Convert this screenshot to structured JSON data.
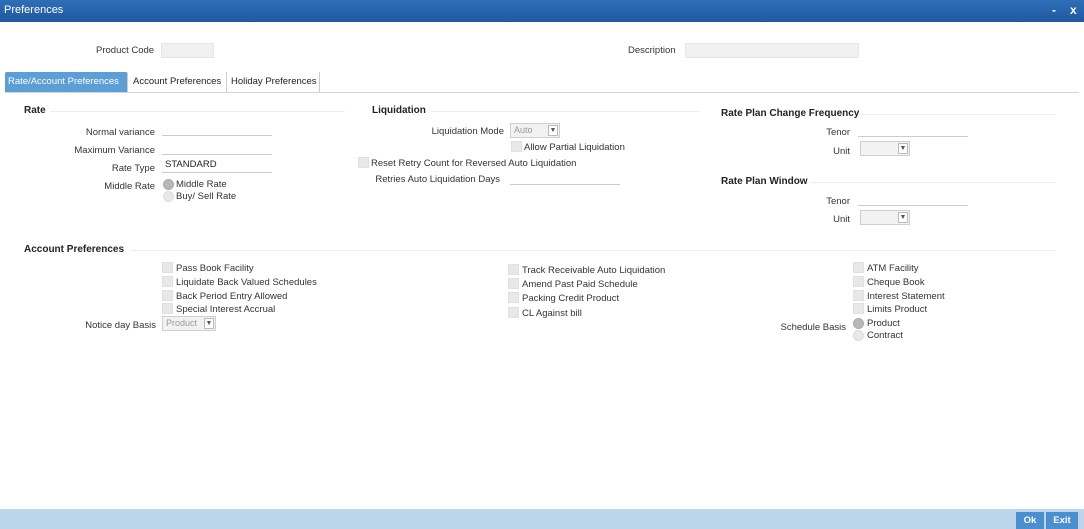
{
  "window": {
    "title": "Preferences",
    "minimize": "-",
    "close": "x"
  },
  "header": {
    "product_code_label": "Product Code",
    "description_label": "Description"
  },
  "tabs": [
    {
      "label": "Rate/Account Preferences",
      "active": true
    },
    {
      "label": "Account Preferences",
      "active": false
    },
    {
      "label": "Holiday Preferences",
      "active": false
    }
  ],
  "rate": {
    "heading": "Rate",
    "normal_variance_label": "Normal variance",
    "maximum_variance_label": "Maximum Variance",
    "rate_type_label": "Rate Type",
    "rate_type_value": "STANDARD",
    "middle_rate_label": "Middle Rate",
    "opt_middle_rate": "Middle Rate",
    "opt_buy_sell_rate": "Buy/ Sell Rate"
  },
  "liquidation": {
    "heading": "Liquidation",
    "mode_label": "Liquidation Mode",
    "mode_value": "Auto",
    "allow_partial_label": "Allow Partial Liquidation",
    "reset_retry_label": "Reset Retry Count for Reversed Auto Liquidation",
    "retries_days_label": "Retries Auto Liquidation Days"
  },
  "rate_plan_change": {
    "heading": "Rate Plan Change Frequency",
    "tenor_label": "Tenor",
    "unit_label": "Unit"
  },
  "rate_plan_window": {
    "heading": "Rate Plan Window",
    "tenor_label": "Tenor",
    "unit_label": "Unit"
  },
  "account_preferences": {
    "heading": "Account Preferences",
    "col1": [
      "Pass Book Facility",
      "Liquidate Back Valued Schedules",
      "Back Period Entry Allowed",
      "Special Interest Accrual"
    ],
    "notice_day_basis_label": "Notice day Basis",
    "notice_day_basis_value": "Product",
    "col2": [
      "Track Receivable Auto Liquidation",
      "Amend Past Paid Schedule",
      "Packing Credit Product",
      "CL Against bill"
    ],
    "col3": [
      "ATM Facility",
      "Cheque Book",
      "Interest Statement",
      "Limits Product"
    ],
    "schedule_basis_label": "Schedule Basis",
    "opt_product": "Product",
    "opt_contract": "Contract"
  },
  "footer": {
    "ok_label": "Ok",
    "exit_label": "Exit"
  },
  "colors": {
    "titlebar": "#1f58a0",
    "active_tab": "#5b9fd6",
    "footer": "#bcd5ea",
    "button": "#4a8fd0"
  }
}
